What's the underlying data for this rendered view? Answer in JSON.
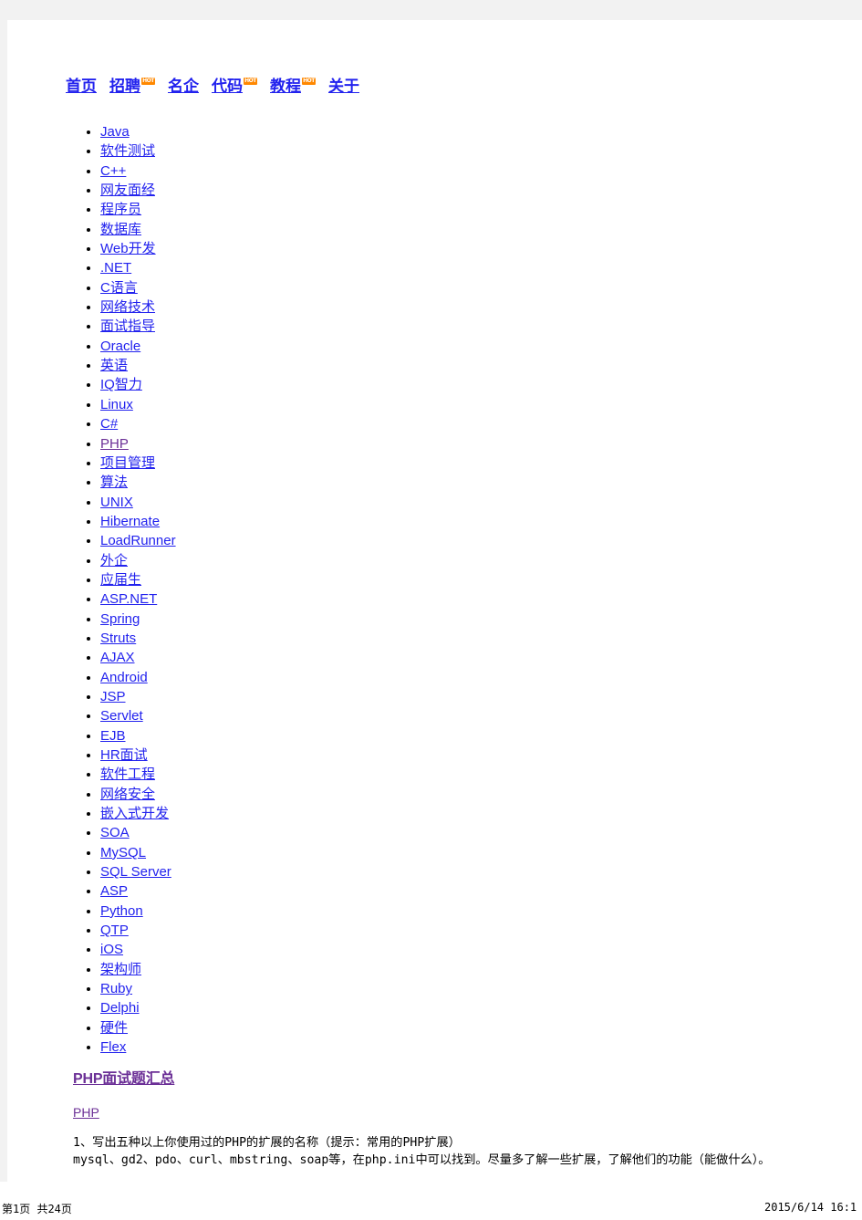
{
  "nav": {
    "items": [
      {
        "label": "首页",
        "badge": ""
      },
      {
        "label": "招聘",
        "badge": "HOT"
      },
      {
        "label": "名企",
        "badge": ""
      },
      {
        "label": "代码",
        "badge": "HOT"
      },
      {
        "label": "教程",
        "badge": "HOT"
      },
      {
        "label": "关于",
        "badge": ""
      }
    ]
  },
  "categories": [
    {
      "label": "Java",
      "visited": false
    },
    {
      "label": "软件测试",
      "visited": false
    },
    {
      "label": "C++",
      "visited": false
    },
    {
      "label": "网友面经",
      "visited": false
    },
    {
      "label": "程序员",
      "visited": false
    },
    {
      "label": "数据库",
      "visited": false
    },
    {
      "label": "Web开发",
      "visited": false
    },
    {
      "label": ".NET",
      "visited": false
    },
    {
      "label": "C语言",
      "visited": false
    },
    {
      "label": "网络技术",
      "visited": false
    },
    {
      "label": "面试指导",
      "visited": false
    },
    {
      "label": "Oracle",
      "visited": false
    },
    {
      "label": "英语",
      "visited": false
    },
    {
      "label": "IQ智力",
      "visited": false
    },
    {
      "label": "Linux",
      "visited": false
    },
    {
      "label": "C#",
      "visited": false
    },
    {
      "label": "PHP",
      "visited": true
    },
    {
      "label": "项目管理",
      "visited": false
    },
    {
      "label": "算法",
      "visited": false
    },
    {
      "label": "UNIX",
      "visited": false
    },
    {
      "label": "Hibernate",
      "visited": false
    },
    {
      "label": "LoadRunner",
      "visited": false
    },
    {
      "label": "外企",
      "visited": false
    },
    {
      "label": "应届生",
      "visited": false
    },
    {
      "label": "ASP.NET",
      "visited": false
    },
    {
      "label": "Spring",
      "visited": false
    },
    {
      "label": "Struts",
      "visited": false
    },
    {
      "label": "AJAX",
      "visited": false
    },
    {
      "label": "Android",
      "visited": false
    },
    {
      "label": "JSP",
      "visited": false
    },
    {
      "label": "Servlet",
      "visited": false
    },
    {
      "label": "EJB",
      "visited": false
    },
    {
      "label": "HR面试",
      "visited": false
    },
    {
      "label": "软件工程",
      "visited": false
    },
    {
      "label": "网络安全",
      "visited": false
    },
    {
      "label": "嵌入式开发",
      "visited": false
    },
    {
      "label": "SOA",
      "visited": false
    },
    {
      "label": "MySQL",
      "visited": false
    },
    {
      "label": "SQL Server",
      "visited": false
    },
    {
      "label": "ASP",
      "visited": false
    },
    {
      "label": "Python",
      "visited": false
    },
    {
      "label": "QTP",
      "visited": false
    },
    {
      "label": "iOS",
      "visited": false
    },
    {
      "label": "架构师",
      "visited": false
    },
    {
      "label": "Ruby",
      "visited": false
    },
    {
      "label": "Delphi",
      "visited": false
    },
    {
      "label": "硬件",
      "visited": false
    },
    {
      "label": "Flex",
      "visited": false
    }
  ],
  "article": {
    "heading": "PHP面试题汇总",
    "tag": "PHP",
    "body": "1、写出五种以上你使用过的PHP的扩展的名称（提示：常用的PHP扩展）\nmysql、gd2、pdo、curl、mbstring、soap等，在php.ini中可以找到。尽量多了解一些扩展，了解他们的功能（能做什么）。"
  },
  "footer": {
    "page_info": "第1页  共24页",
    "timestamp": "2015/6/14 16:1"
  },
  "colors": {
    "link": "#2222ee",
    "visited_link": "#6b2f96",
    "badge": "#ff8800",
    "page_background": "#ffffff",
    "canvas_background": "#f2f2f2"
  }
}
